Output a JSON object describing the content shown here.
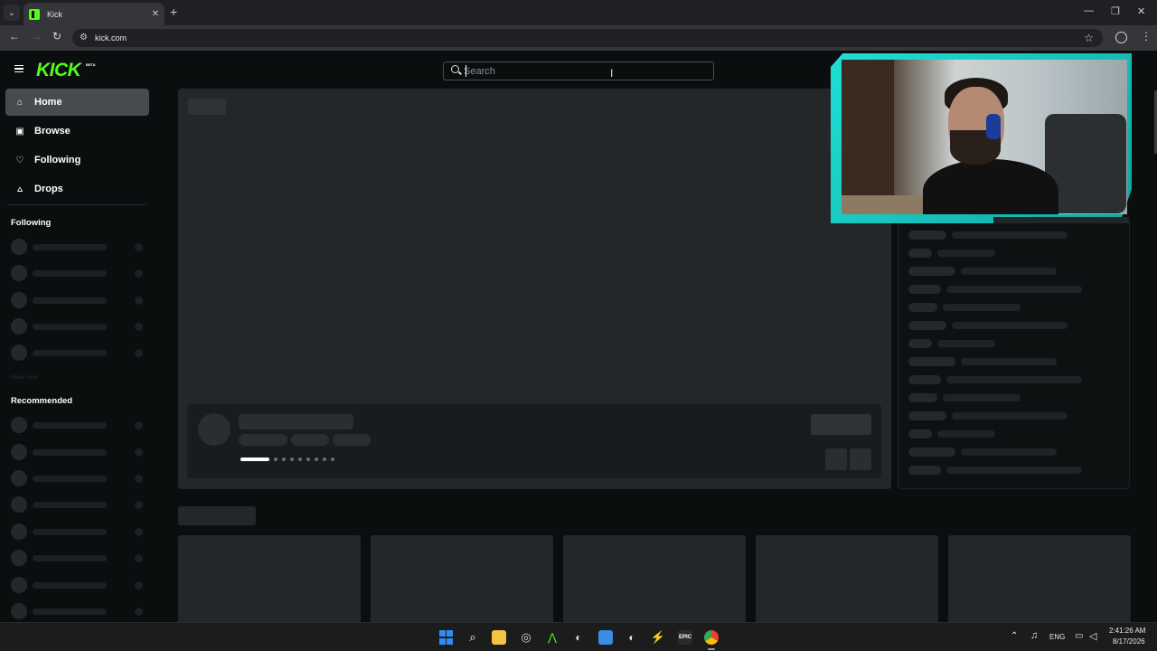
{
  "browser": {
    "tab_title": "Kick",
    "tab_close": "✕",
    "new_tab": "+",
    "url": "kick.com",
    "window_controls": [
      "—",
      "❐",
      "✕"
    ]
  },
  "kick": {
    "logo": "KICK",
    "beta": "BETA",
    "search_placeholder": "Search"
  },
  "sidebar": {
    "nav": [
      {
        "label": "Home",
        "icon": "home-icon",
        "active": true
      },
      {
        "label": "Browse",
        "icon": "browse-icon",
        "active": false
      },
      {
        "label": "Following",
        "icon": "heart-icon",
        "active": false
      },
      {
        "label": "Drops",
        "icon": "drops-icon",
        "active": false
      }
    ],
    "following_heading": "Following",
    "show_more": "Show more",
    "recommended_heading": "Recommended"
  },
  "taskbar": {
    "language": "ENG",
    "time": "2:41:26 AM",
    "date": "8/17/2026"
  },
  "colors": {
    "accent": "#53fc18",
    "webcam_frame": "#1fe0d6"
  }
}
